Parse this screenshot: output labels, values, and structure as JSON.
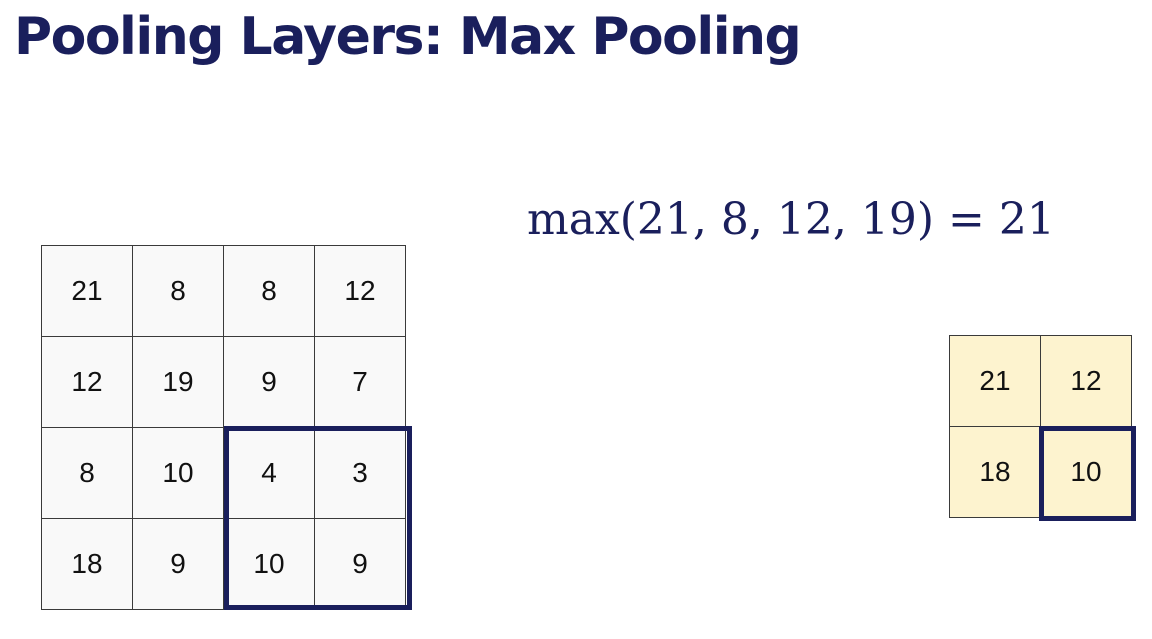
{
  "slide": {
    "title": "Pooling Layers: Max Pooling",
    "formula": "max(21, 8, 12, 19) = 21"
  },
  "input_matrix": [
    [
      "21",
      "8",
      "8",
      "12"
    ],
    [
      "12",
      "19",
      "9",
      "7"
    ],
    [
      "8",
      "10",
      "4",
      "3"
    ],
    [
      "18",
      "9",
      "10",
      "9"
    ]
  ],
  "output_matrix": [
    [
      "21",
      "12"
    ],
    [
      "18",
      "10"
    ]
  ],
  "highlight": {
    "input_window": "bottom-right 2x2",
    "output_cell": "bottom-right"
  },
  "colors": {
    "title": "#1a1f5c",
    "highlight_border": "#1a1f5c",
    "output_fill": "#fdf3cf",
    "input_fill": "#f9f9f9"
  }
}
